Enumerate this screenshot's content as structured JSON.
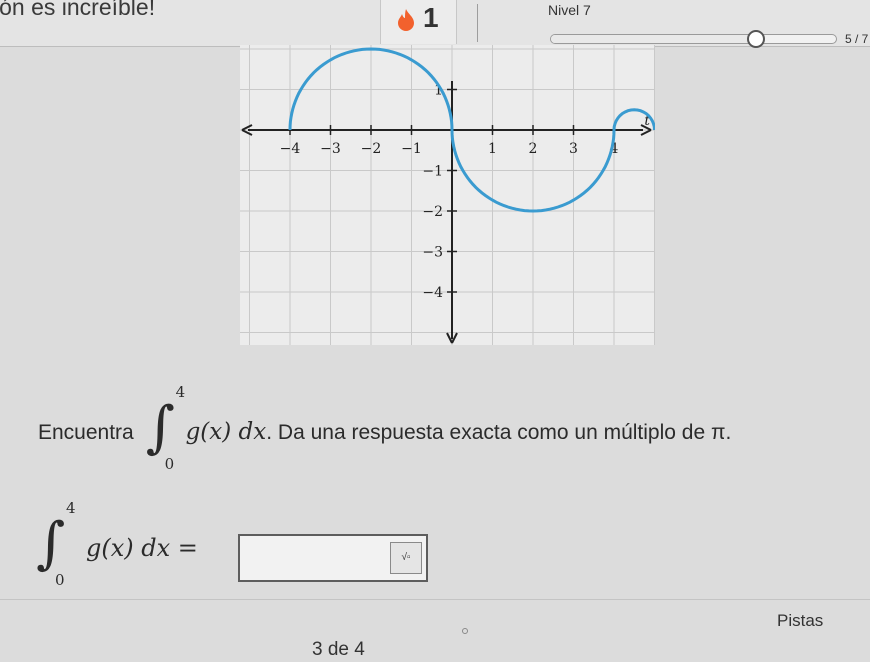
{
  "header": {
    "message": "ión es increíble!",
    "streak": "1",
    "level_label": "Nivel 7",
    "progress": {
      "current": 5,
      "total": 7,
      "label": "5 / 7"
    }
  },
  "graph": {
    "x_ticks": [
      "−4",
      "−3",
      "−2",
      "−1",
      "1",
      "2",
      "3",
      "4"
    ],
    "y_ticks": [
      "1",
      "−1",
      "−2",
      "−3",
      "−4"
    ],
    "axis_var": "t",
    "curve_color": "#3a9bd0"
  },
  "question": {
    "prefix": "Encuentra",
    "integral_upper": "4",
    "integral_lower": "0",
    "integrand": "g(x) dx",
    "suffix": ". Da una respuesta exacta como un múltiplo de π."
  },
  "answer": {
    "integral_upper": "4",
    "integral_lower": "0",
    "lhs": "g(x) dx =",
    "value": ""
  },
  "footer": {
    "hints_label": "Pistas",
    "page_label": "3 de 4"
  }
}
